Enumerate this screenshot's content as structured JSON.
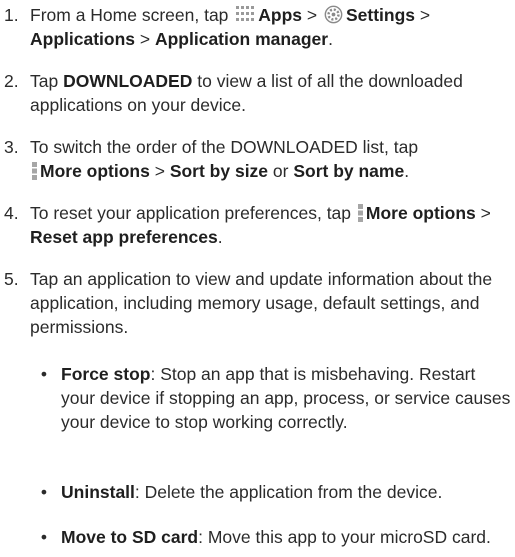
{
  "steps": [
    {
      "num": "1.",
      "parts": [
        {
          "t": "From a Home screen, tap ",
          "b": false
        },
        {
          "icon": "apps-icon"
        },
        {
          "t": "Apps",
          "b": true
        },
        {
          "t": " > ",
          "b": false
        },
        {
          "icon": "gear-icon"
        },
        {
          "t": "Settings",
          "b": true
        },
        {
          "t": " > ",
          "b": false
        },
        {
          "t": "Applications",
          "b": true
        },
        {
          "t": " > ",
          "b": false
        },
        {
          "t": "Application manager",
          "b": true
        },
        {
          "t": ".",
          "b": false
        }
      ]
    },
    {
      "num": "2.",
      "parts": [
        {
          "t": "Tap ",
          "b": false
        },
        {
          "t": "DOWNLOADED",
          "b": true
        },
        {
          "t": " to view a list of all the downloaded applications on your device.",
          "b": false
        }
      ]
    },
    {
      "num": "3.",
      "parts": [
        {
          "t": "To switch the order of the DOWNLOADED list, tap ",
          "b": false
        },
        {
          "icon": "more-options-icon"
        },
        {
          "t": "More options",
          "b": true
        },
        {
          "t": " > ",
          "b": false
        },
        {
          "t": "Sort by size",
          "b": true
        },
        {
          "t": " or ",
          "b": false
        },
        {
          "t": "Sort by name",
          "b": true
        },
        {
          "t": ".",
          "b": false
        }
      ]
    },
    {
      "num": "4.",
      "parts": [
        {
          "t": "To reset your application preferences, tap ",
          "b": false
        },
        {
          "icon": "more-options-icon"
        },
        {
          "t": "More options",
          "b": true
        },
        {
          "t": " > ",
          "b": false
        },
        {
          "t": "Reset app preferences",
          "b": true
        },
        {
          "t": ".",
          "b": false
        }
      ]
    },
    {
      "num": "5.",
      "parts": [
        {
          "t": "Tap an application to view and update information about the application, including memory usage, default settings, and permissions.",
          "b": false
        }
      ]
    }
  ],
  "bullets": [
    {
      "dot": "•",
      "parts": [
        {
          "t": "Force stop",
          "b": true
        },
        {
          "t": ": Stop an app that is misbehaving. Restart your device if stopping an app, process, or service causes your device to stop working correctly.",
          "b": false
        }
      ]
    },
    {
      "dot": "•",
      "parts": [
        {
          "t": "Uninstall",
          "b": true
        },
        {
          "t": ": Delete the application from the device.",
          "b": false
        }
      ]
    },
    {
      "dot": "•",
      "parts": [
        {
          "t": "Move to SD card",
          "b": true
        },
        {
          "t": ": Move this app to your microSD card.",
          "b": false
        }
      ]
    }
  ]
}
